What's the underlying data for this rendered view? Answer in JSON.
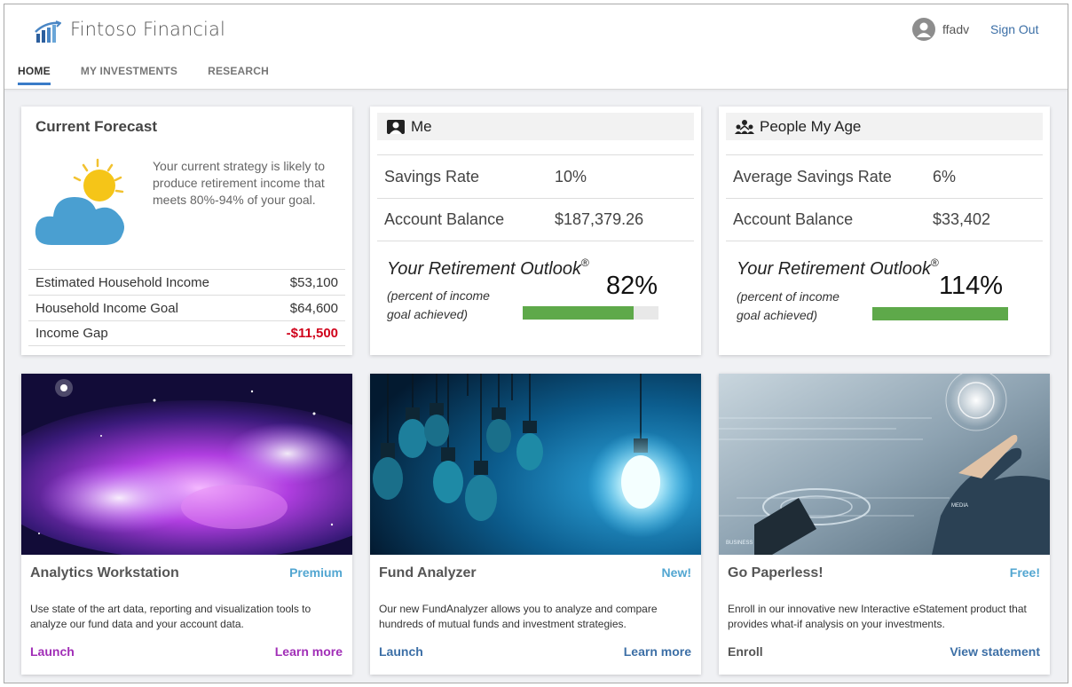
{
  "header": {
    "brand": "Fintoso Financial",
    "username": "ffadv",
    "sign_out": "Sign Out",
    "tabs": [
      "HOME",
      "MY INVESTMENTS",
      "RESEARCH"
    ]
  },
  "forecast": {
    "title": "Current Forecast",
    "text": "Your current strategy is likely to produce retirement income that meets 80%-94% of your goal.",
    "rows": [
      {
        "label": "Estimated Household Income",
        "value": "$53,100"
      },
      {
        "label": "Household Income Goal",
        "value": "$64,600"
      },
      {
        "label": "Income Gap",
        "value": "-$11,500"
      }
    ]
  },
  "me": {
    "title": "Me",
    "rows": [
      {
        "label": "Savings Rate",
        "value": "10%"
      },
      {
        "label": "Account Balance",
        "value": "$187,379.26"
      }
    ],
    "outlook_title": "Your Retirement Outlook",
    "outlook_mark": "®",
    "outlook_sub_1": "(percent of income",
    "outlook_sub_2": "goal achieved)",
    "percent": "82%",
    "fraction": 0.82
  },
  "peers": {
    "title": "People My Age",
    "rows": [
      {
        "label": "Average Savings Rate",
        "value": "6%"
      },
      {
        "label": "Account Balance",
        "value": "$33,402"
      }
    ],
    "outlook_title": "Your Retirement Outlook",
    "outlook_mark": "®",
    "outlook_sub_1": "(percent of income",
    "outlook_sub_2": "goal achieved)",
    "percent": "114%",
    "fraction": 1.0
  },
  "features": [
    {
      "title": "Analytics Workstation",
      "badge": "Premium",
      "desc": "Use state of the art data, reporting and visualization tools to analyze our fund data and your account data.",
      "link_left": "Launch",
      "link_right": "Learn more"
    },
    {
      "title": "Fund Analyzer",
      "badge": "New!",
      "desc": "Our new FundAnalyzer allows you to analyze and compare hundreds of mutual funds and investment strategies.",
      "link_left": "Launch",
      "link_right": "Learn more"
    },
    {
      "title": "Go Paperless!",
      "badge": "Free!",
      "desc": "Enroll in our innovative new Interactive eStatement product that provides what-if analysis on your investments.",
      "link_left": "Enroll",
      "link_right": "View statement",
      "image_text_1": "MEDIA",
      "image_text_2": "BUSINESS"
    }
  ],
  "colors": {
    "accent": "#3a7bc8",
    "negative": "#d0021b",
    "badge": "#52a6d1",
    "bar": "#5ea94a",
    "link_purple": "#a12fb7",
    "link_blue": "#3c6fa6"
  }
}
